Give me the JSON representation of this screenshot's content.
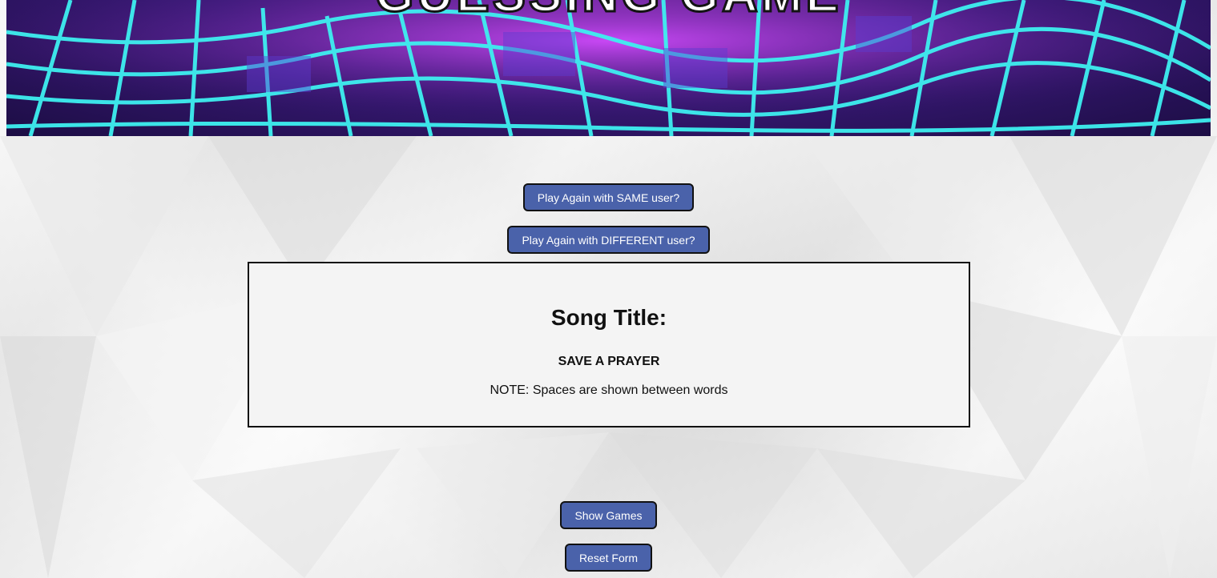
{
  "banner": {
    "title": "GUESSING GAME"
  },
  "buttons": {
    "play_same": "Play Again with SAME user?",
    "play_different": "Play Again with DIFFERENT user?",
    "show_games": "Show Games",
    "reset_form": "Reset Form"
  },
  "song": {
    "heading": "Song Title:",
    "title": "SAVE A PRAYER",
    "note": "NOTE: Spaces are shown between words"
  },
  "colors": {
    "button_bg": "#4a62aa",
    "grid_glow": "#3ef0f0",
    "banner_purple": "#3b1a7a"
  }
}
